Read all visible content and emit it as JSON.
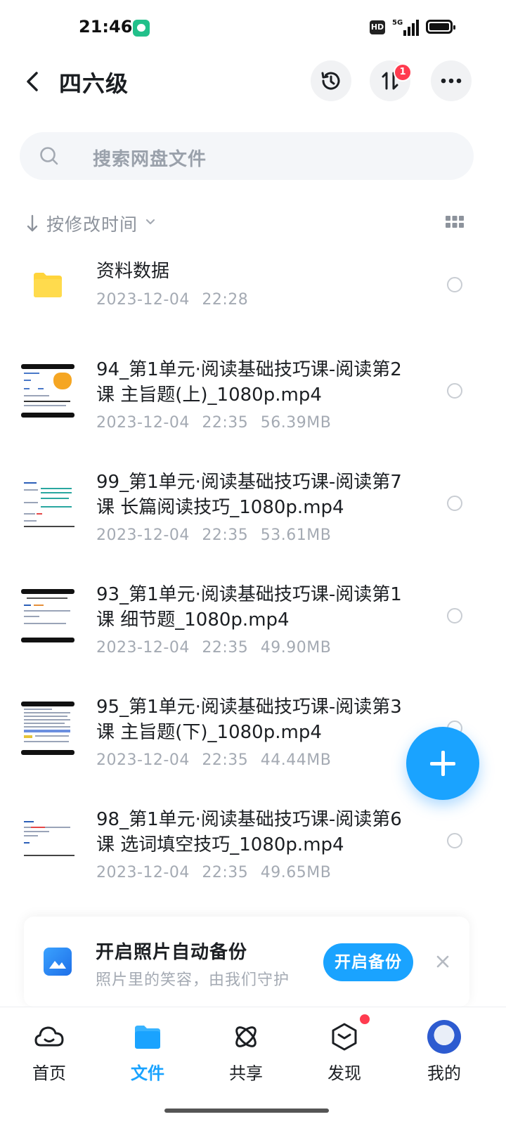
{
  "status_bar": {
    "time": "21:46",
    "hd": "HD",
    "network": "5G"
  },
  "header": {
    "title": "四六级",
    "transfer_badge": "1"
  },
  "search": {
    "placeholder": "搜索网盘文件"
  },
  "sort": {
    "label": "按修改时间"
  },
  "files": [
    {
      "name": "资料数据",
      "date": "2023-12-04",
      "time": "22:28",
      "size": "",
      "type": "folder"
    },
    {
      "name": "94_第1单元·阅读基础技巧课-阅读第2课 主旨题(上)_1080p.mp4",
      "date": "2023-12-04",
      "time": "22:35",
      "size": "56.39MB",
      "type": "video"
    },
    {
      "name": "99_第1单元·阅读基础技巧课-阅读第7课 长篇阅读技巧_1080p.mp4",
      "date": "2023-12-04",
      "time": "22:35",
      "size": "53.61MB",
      "type": "video"
    },
    {
      "name": "93_第1单元·阅读基础技巧课-阅读第1课 细节题_1080p.mp4",
      "date": "2023-12-04",
      "time": "22:35",
      "size": "49.90MB",
      "type": "video"
    },
    {
      "name": "95_第1单元·阅读基础技巧课-阅读第3课 主旨题(下)_1080p.mp4",
      "date": "2023-12-04",
      "time": "22:35",
      "size": "44.44MB",
      "type": "video"
    },
    {
      "name": "98_第1单元·阅读基础技巧课-阅读第6课 选词填空技巧_1080p.mp4",
      "date": "2023-12-04",
      "time": "22:35",
      "size": "49.65MB",
      "type": "video"
    }
  ],
  "backup": {
    "title": "开启照片自动备份",
    "subtitle": "照片里的笑容，由我们守护",
    "button": "开启备份"
  },
  "tabs": [
    {
      "label": "首页",
      "icon": "cloud-home-icon"
    },
    {
      "label": "文件",
      "icon": "folder-icon",
      "active": true
    },
    {
      "label": "共享",
      "icon": "share-atom-icon"
    },
    {
      "label": "发现",
      "icon": "discover-cube-icon"
    },
    {
      "label": "我的",
      "icon": "avatar"
    }
  ],
  "colors": {
    "accent": "#1aa3ff",
    "badge": "#ff3b4f",
    "folder": "#ffd43b"
  }
}
